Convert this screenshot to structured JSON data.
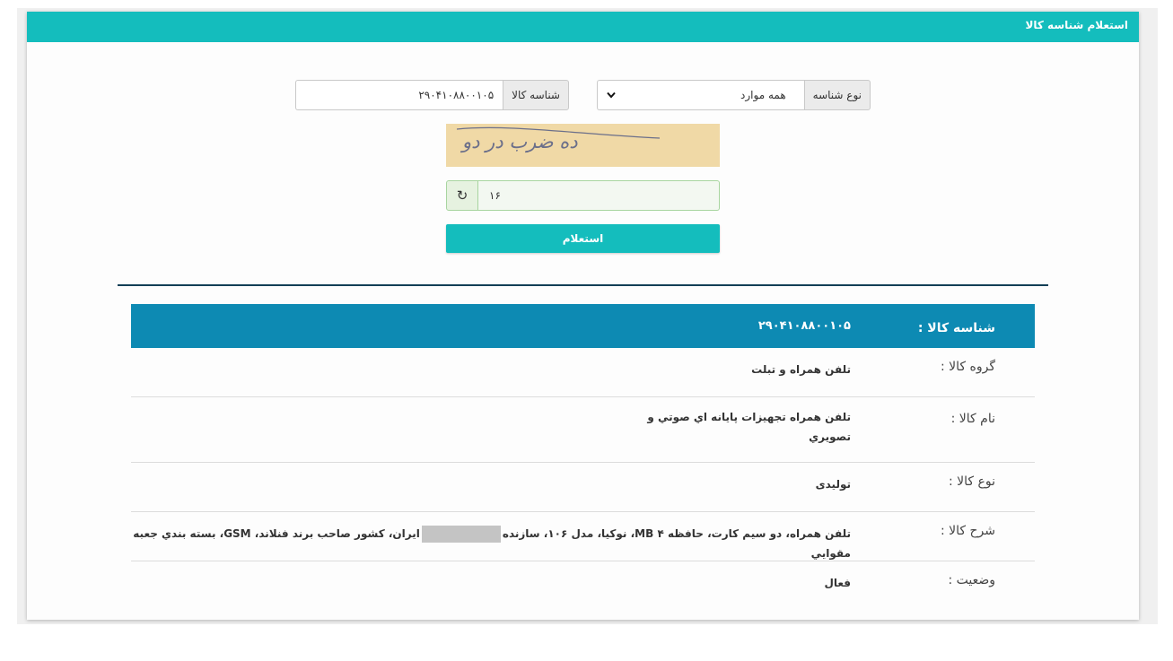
{
  "header": {
    "title": "استعلام شناسه کالا"
  },
  "form": {
    "id_type": {
      "label": "نوع شناسه",
      "selected": "همه موارد"
    },
    "product_id": {
      "label": "شناسه کالا",
      "value": "۲۹۰۴۱۰۸۸۰۰۱۰۵"
    },
    "captcha": {
      "image_text": "ده ضرب در دو",
      "answer": "۱۶"
    },
    "submit_label": "استعلام"
  },
  "result": {
    "header": {
      "label": "شناسه کالا :",
      "value": "۲۹۰۴۱۰۸۸۰۰۱۰۵"
    },
    "rows": [
      {
        "label": "گروه کالا :",
        "value": "تلفن همراه و تبلت"
      },
      {
        "label": "نام کالا :",
        "value": "تلفن همراه تجهیزات پایانه اي صوتي و تصويري"
      },
      {
        "label": "نوع کالا :",
        "value": "تولیدی"
      },
      {
        "label": "شرح کالا :",
        "value_before": "تلفن همراه، دو سیم کارت، حافظه ۴ MB، نوکیا، مدل ۱۰۶، سازنده",
        "value_after": "ایران، کشور صاحب برند فنلاند، GSM، بسته بندي جعبه مقوايي"
      },
      {
        "label": "وضعیت :",
        "value": "فعال"
      }
    ]
  },
  "colors": {
    "accent": "#14bdbd",
    "result_header": "#0d8ab3",
    "divider": "#123f56"
  }
}
